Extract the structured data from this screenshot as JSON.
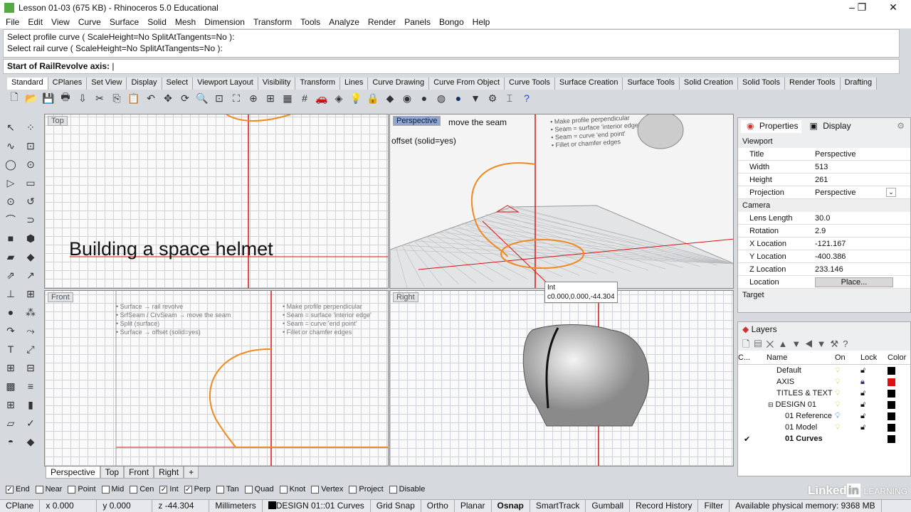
{
  "window": {
    "title": "Lesson 01-03 (675 KB) - Rhinoceros 5.0 Educational"
  },
  "menu": [
    "File",
    "Edit",
    "View",
    "Curve",
    "Surface",
    "Solid",
    "Mesh",
    "Dimension",
    "Transform",
    "Tools",
    "Analyze",
    "Render",
    "Panels",
    "Bongo",
    "Help"
  ],
  "command": {
    "history": [
      "Select profile curve ( ScaleHeight=No  SplitAtTangents=No ):",
      "Select rail curve ( ScaleHeight=No  SplitAtTangents=No ):"
    ],
    "prompt": "Start of RailRevolve axis:",
    "input": ""
  },
  "toolbar_tabs": [
    "Standard",
    "CPlanes",
    "Set View",
    "Display",
    "Select",
    "Viewport Layout",
    "Visibility",
    "Transform",
    "Lines",
    "Curve Drawing",
    "Curve From Object",
    "Curve Tools",
    "Surface Creation",
    "Surface Tools",
    "Solid Creation",
    "Solid Tools",
    "Render Tools",
    "Drafting"
  ],
  "toolbar_icons": [
    "new",
    "open",
    "save",
    "print",
    "import",
    "cut",
    "copy",
    "paste",
    "undo",
    "pan",
    "rotate",
    "zoom",
    "zoom-window",
    "zoom-extents",
    "zoom-selected",
    "zoom-all",
    "four-viewports",
    "grid",
    "car",
    "layer",
    "light",
    "lock",
    "material",
    "color-wheel",
    "sphere-shaded",
    "sphere-wire",
    "sphere-render",
    "light-cone",
    "gear-group",
    "dimension",
    "help"
  ],
  "viewports": {
    "top": {
      "label": "Top",
      "overlay_text": "Building a space helmet"
    },
    "perspective": {
      "label": "Perspective",
      "notes_left": [
        "move the seam",
        "offset (solid=yes)"
      ],
      "notes_right": [
        "• Make profile perpendicular",
        "• Seam = surface 'interior edge'",
        "• Seam = curve 'end point'",
        "• Fillet or chamfer edges"
      ],
      "tooltip_title": "Int",
      "tooltip_coords": "c0.000,0.000,-44.304"
    },
    "front": {
      "label": "Front",
      "notes_left": [
        "• Surface → rail revolve",
        "• SrfSeam / CrvSeam → move the seam",
        "• Split (surface)",
        "• Surface → offset (solid=yes)"
      ],
      "notes_right": [
        "• Make profile perpendicular",
        "• Seam = surface 'interior edge'",
        "• Seam = curve 'end point'",
        "• Fillet or chamfer edges"
      ]
    },
    "right": {
      "label": "Right"
    }
  },
  "viewport_tabs": [
    "Perspective",
    "Top",
    "Front",
    "Right"
  ],
  "properties": {
    "tabs": [
      "Properties",
      "Display"
    ],
    "sections": [
      {
        "title": "Viewport",
        "rows": [
          [
            "Title",
            "Perspective"
          ],
          [
            "Width",
            "513"
          ],
          [
            "Height",
            "261"
          ],
          [
            "Projection",
            "Perspective"
          ]
        ]
      },
      {
        "title": "Camera",
        "rows": [
          [
            "Lens Length",
            "30.0"
          ],
          [
            "Rotation",
            "2.9"
          ],
          [
            "X Location",
            "-121.167"
          ],
          [
            "Y Location",
            "-400.386"
          ],
          [
            "Z Location",
            "233.146"
          ],
          [
            "Location",
            "Place..."
          ]
        ]
      },
      {
        "title": "Target",
        "rows": []
      }
    ]
  },
  "layers": {
    "title": "Layers",
    "columns": [
      "C...",
      "Name",
      "On",
      "Lock",
      "Color"
    ],
    "rows": [
      {
        "name": "Default",
        "on": true,
        "locked": false,
        "color": "#000000",
        "current": false
      },
      {
        "name": "AXIS",
        "on": true,
        "locked": true,
        "color": "#dd1111",
        "current": false
      },
      {
        "name": "TITLES & TEXT",
        "on": true,
        "locked": false,
        "color": "#000000",
        "current": false
      },
      {
        "name": "DESIGN 01",
        "on": true,
        "locked": false,
        "color": "#000000",
        "current": false,
        "expanded": true
      },
      {
        "name": "01 Reference",
        "on": true,
        "locked": false,
        "color": "#000000",
        "current": false
      },
      {
        "name": "01 Model",
        "on": true,
        "locked": false,
        "color": "#000000",
        "current": false
      },
      {
        "name": "01 Curves",
        "on": true,
        "locked": false,
        "color": "#000000",
        "current": true
      }
    ]
  },
  "osnap": [
    {
      "label": "End",
      "checked": true
    },
    {
      "label": "Near",
      "checked": false
    },
    {
      "label": "Point",
      "checked": false
    },
    {
      "label": "Mid",
      "checked": false
    },
    {
      "label": "Cen",
      "checked": false
    },
    {
      "label": "Int",
      "checked": true
    },
    {
      "label": "Perp",
      "checked": true
    },
    {
      "label": "Tan",
      "checked": false
    },
    {
      "label": "Quad",
      "checked": false
    },
    {
      "label": "Knot",
      "checked": false
    },
    {
      "label": "Vertex",
      "checked": false
    },
    {
      "label": "Project",
      "checked": false
    },
    {
      "label": "Disable",
      "checked": false
    }
  ],
  "status": {
    "cplane": "CPlane",
    "x": "x 0.000",
    "y": "y 0.000",
    "z": "z -44.304",
    "units": "Millimeters",
    "layer": "DESIGN 01::01 Curves",
    "toggles": [
      "Grid Snap",
      "Ortho",
      "Planar",
      "Osnap",
      "SmartTrack",
      "Gumball",
      "Record History",
      "Filter"
    ],
    "active_toggle": "Osnap",
    "memory": "Available physical memory: 9368 MB"
  },
  "branding": "Linked in LEARNING",
  "colors": {
    "curve": "#f08a1c",
    "axis": "#dd1111",
    "active_viewport": "#8ea6d1"
  }
}
